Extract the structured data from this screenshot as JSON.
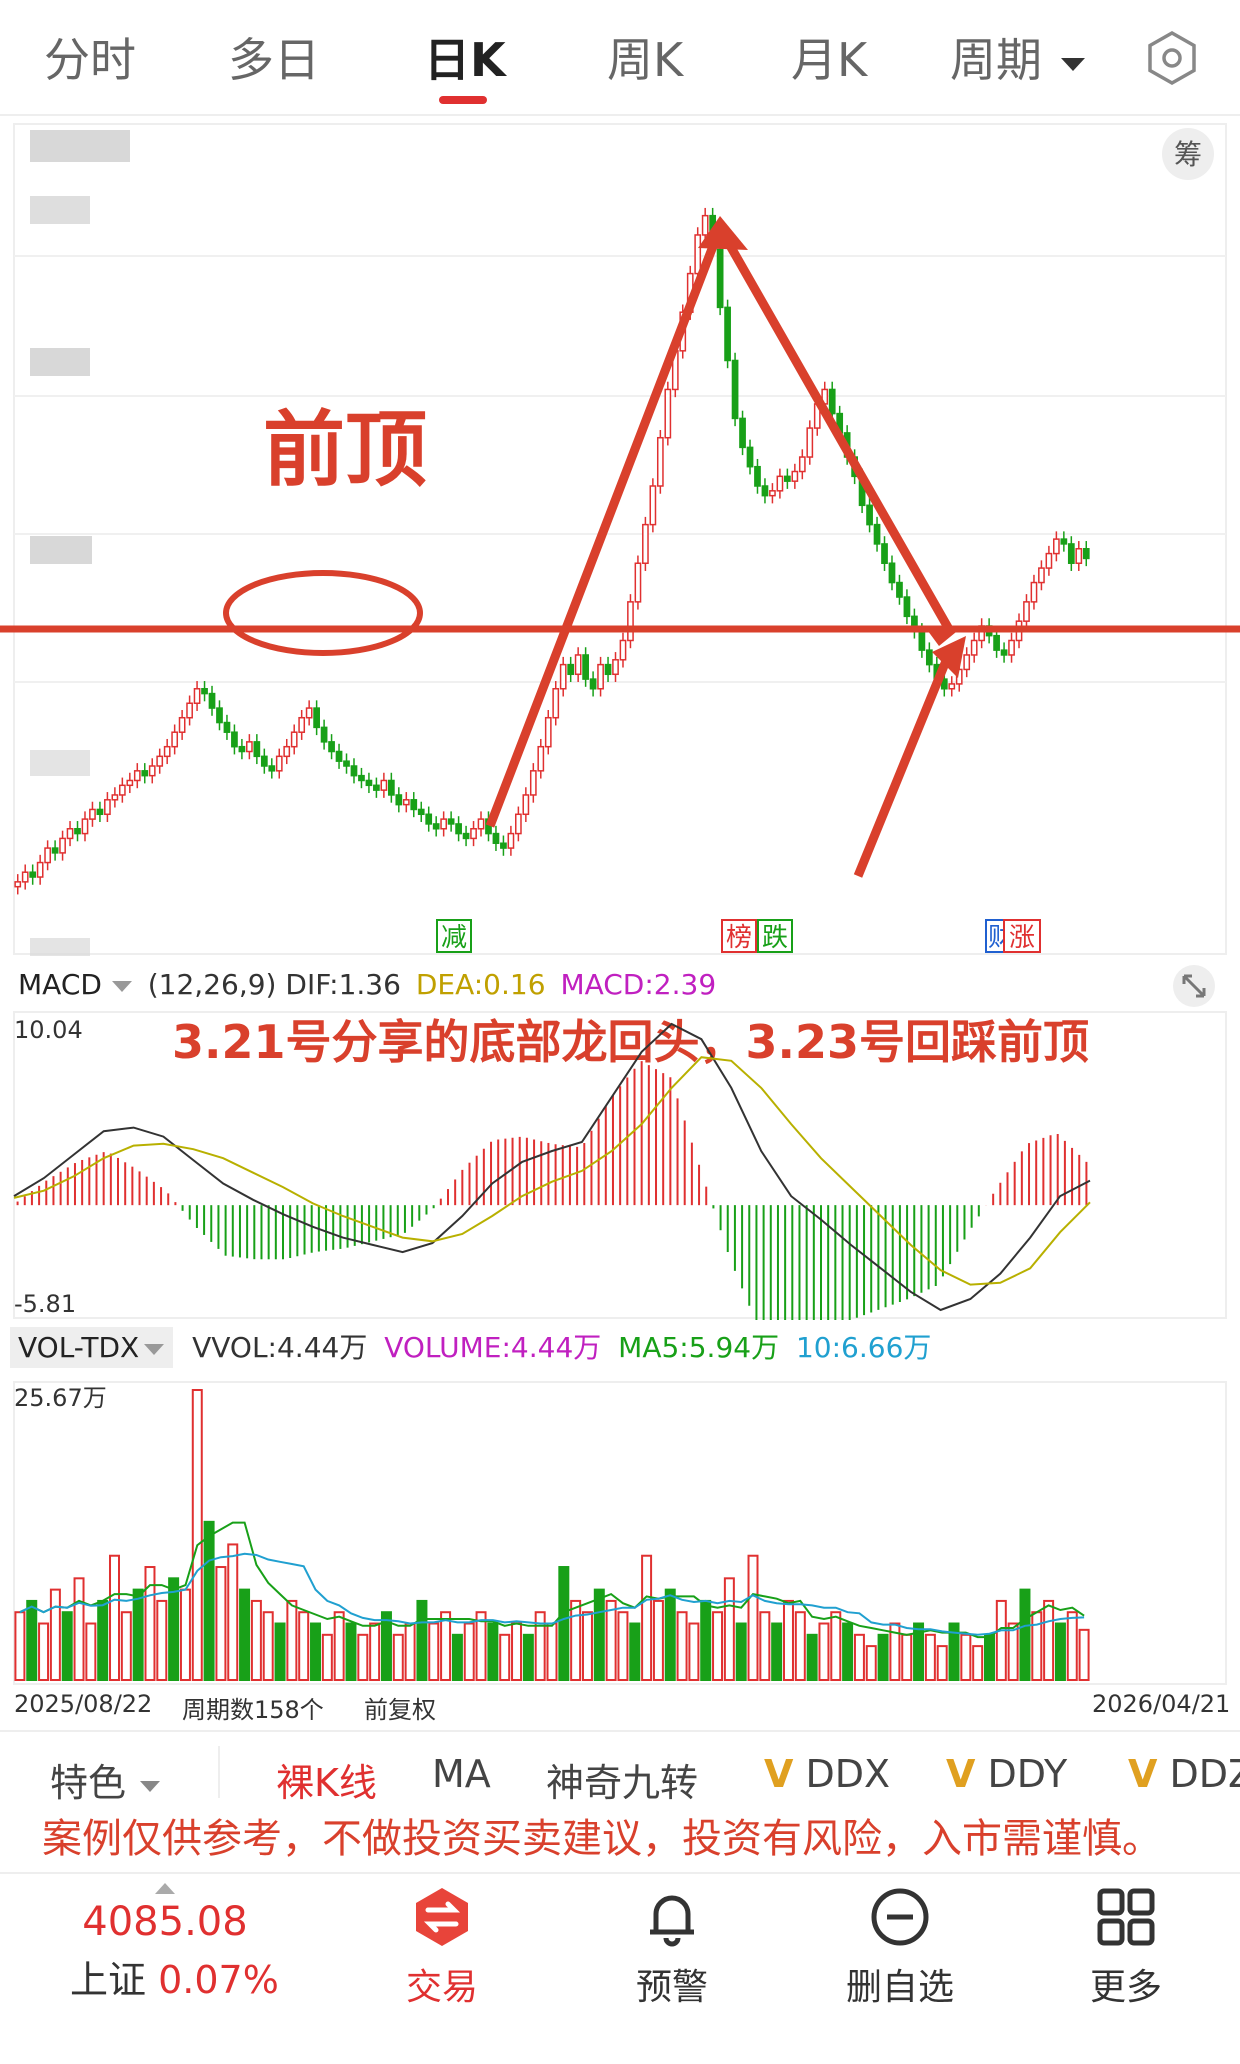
{
  "tabs": [
    {
      "label": "分时"
    },
    {
      "label": "多日"
    },
    {
      "label": "日K"
    },
    {
      "label": "周K"
    },
    {
      "label": "月K"
    },
    {
      "label": "周期"
    }
  ],
  "chip_button": "筹",
  "annotations": {
    "prev_top": "前顶",
    "note": "3.21号分享的底部龙回头，3.23号回踩前顶",
    "disclaimer": "案例仅供参考，不做投资买卖建议，投资有风险，入市需谨慎。"
  },
  "event_markers": [
    "减",
    "榜",
    "跌",
    "财",
    "涨"
  ],
  "macd": {
    "name": "MACD",
    "params": "(12,26,9)",
    "dif": "DIF:1.36",
    "dea": "DEA:0.16",
    "macd": "MACD:2.39",
    "max": "10.04",
    "min": "-5.81"
  },
  "volume": {
    "name": "VOL-TDX",
    "vvol": "VVOL:4.44万",
    "volume": "VOLUME:4.44万",
    "ma5": "MA5:5.94万",
    "ma10": "10:6.66万",
    "max": "25.67万"
  },
  "footer_axis": {
    "start": "2025/08/22",
    "periods": "周期数158个",
    "adjust": "前复权",
    "end": "2026/04/21"
  },
  "toolbar": [
    "特色",
    "裸K线",
    "MA",
    "神奇九转",
    "DDX",
    "DDY",
    "DDZ"
  ],
  "index": {
    "value": "4085.08",
    "name": "上证",
    "change": "0.07%"
  },
  "bottom_nav": [
    {
      "label": "交易",
      "icon": "trade-icon"
    },
    {
      "label": "预警",
      "icon": "bell-icon"
    },
    {
      "label": "删自选",
      "icon": "remove-icon"
    },
    {
      "label": "更多",
      "icon": "grid-icon"
    }
  ],
  "colors": {
    "up": "#e03030",
    "down": "#18a018",
    "accent": "#e03030",
    "annotation": "#d9402c"
  },
  "chart_data": [
    {
      "type": "candlestick",
      "series": [
        {
          "name": "close",
          "values": [
            100,
            102,
            101,
            104,
            107,
            106,
            109,
            111,
            110,
            113,
            115,
            114,
            117,
            118,
            120,
            121,
            123,
            122,
            124,
            126,
            128,
            131,
            134,
            137,
            140,
            139,
            136,
            133,
            131,
            128,
            127,
            129,
            126,
            124,
            123,
            126,
            128,
            131,
            134,
            136,
            132,
            129,
            127,
            125,
            124,
            122,
            121,
            120,
            119,
            121,
            118,
            116,
            117,
            115,
            114,
            112,
            111,
            113,
            112,
            110,
            109,
            111,
            113,
            110,
            108,
            107,
            110,
            114,
            118,
            123,
            128,
            134,
            140,
            145,
            143,
            147,
            142,
            140,
            145,
            143,
            146,
            150,
            158,
            166,
            174,
            182,
            192,
            202,
            210,
            218,
            226,
            234,
            238,
            231,
            219,
            208,
            196,
            190,
            186,
            182,
            180,
            181,
            184,
            183,
            185,
            188,
            194,
            199,
            202,
            197,
            193,
            188,
            184,
            178,
            174,
            170,
            166,
            162,
            159,
            155,
            152,
            148,
            145,
            142,
            140,
            141,
            144,
            147,
            150,
            153,
            151,
            148,
            147,
            150,
            154,
            158,
            162,
            165,
            168,
            171,
            170,
            166,
            169,
            167
          ]
        }
      ]
    },
    {
      "type": "line",
      "name": "MACD",
      "categories": [],
      "series": [
        {
          "name": "DIF",
          "values": [
            0.5,
            1.5,
            2.8,
            4.1,
            4.3,
            3.8,
            2.5,
            1.2,
            0.3,
            -0.5,
            -1.2,
            -1.8,
            -2.2,
            -2.6,
            -2.1,
            -0.6,
            1.2,
            2.4,
            3.0,
            3.5,
            6.0,
            8.5,
            10.04,
            9.2,
            6.5,
            3.0,
            0.5,
            -0.8,
            -2.2,
            -3.5,
            -4.8,
            -5.81,
            -5.2,
            -3.8,
            -1.8,
            0.5,
            1.36
          ]
        },
        {
          "name": "DEA",
          "values": [
            0.4,
            0.8,
            1.6,
            2.6,
            3.3,
            3.4,
            3.1,
            2.6,
            1.8,
            1.0,
            0.1,
            -0.6,
            -1.2,
            -1.8,
            -2.0,
            -1.6,
            -0.6,
            0.5,
            1.3,
            1.9,
            3.0,
            4.5,
            6.5,
            8.2,
            8.0,
            6.5,
            4.5,
            2.6,
            1.0,
            -0.6,
            -2.2,
            -3.6,
            -4.4,
            -4.3,
            -3.5,
            -1.5,
            0.16
          ]
        }
      ],
      "ylim": [
        -5.81,
        10.04
      ]
    },
    {
      "type": "bar",
      "name": "VOL-TDX",
      "series": [
        {
          "name": "VOLUME",
          "values": [
            6,
            7,
            5,
            8,
            6,
            9,
            5,
            7,
            11,
            6,
            8,
            10,
            7,
            9,
            8,
            25.67,
            14,
            10,
            12,
            8,
            7,
            6,
            5,
            7,
            6,
            5,
            4,
            6,
            5,
            4,
            5,
            6,
            4,
            5,
            7,
            5,
            6,
            4,
            5,
            6,
            5,
            4,
            5,
            4,
            6,
            5,
            10,
            7,
            6,
            8,
            7,
            6,
            5,
            11,
            7,
            8,
            6,
            5,
            7,
            6,
            9,
            5,
            11,
            6,
            5,
            7,
            6,
            4,
            5,
            6,
            5,
            4,
            3,
            4,
            5,
            4,
            5,
            4,
            3,
            5,
            4,
            3,
            4,
            7,
            5,
            8,
            6,
            7,
            5,
            6,
            4.44
          ]
        }
      ],
      "ylim": [
        0,
        25.67
      ]
    }
  ]
}
